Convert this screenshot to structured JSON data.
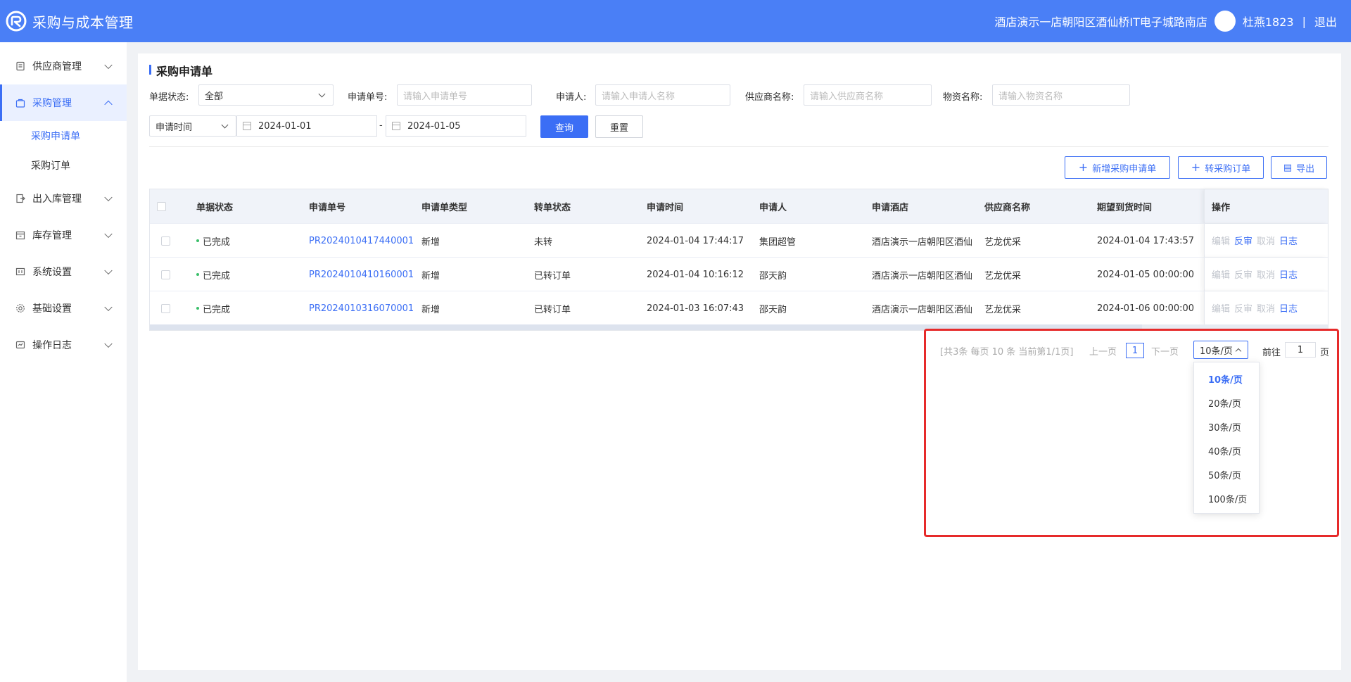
{
  "header": {
    "app_title": "采购与成本管理",
    "store_name": "酒店演示一店朝阳区酒仙桥IT电子城路南店",
    "user_name": "杜燕1823",
    "separator": "|",
    "logout": "退出",
    "brand_color": "#4a7ff6"
  },
  "sidebar": {
    "items": [
      {
        "label": "供应商管理",
        "icon": "supplier-icon"
      },
      {
        "label": "采购管理",
        "icon": "bag-icon",
        "active": true
      },
      {
        "label": "出入库管理",
        "icon": "inout-icon"
      },
      {
        "label": "库存管理",
        "icon": "inventory-icon"
      },
      {
        "label": "系统设置",
        "icon": "settings-icon"
      },
      {
        "label": "基础设置",
        "icon": "gear-icon"
      },
      {
        "label": "操作日志",
        "icon": "log-icon"
      }
    ],
    "purchase_sub": [
      {
        "label": "采购申请单",
        "current": true
      },
      {
        "label": "采购订单"
      }
    ]
  },
  "page": {
    "title": "采购申请单"
  },
  "filters": {
    "status_label": "单据状态:",
    "status_value": "全部",
    "order_no_label": "申请单号:",
    "order_no_placeholder": "请输入申请单号",
    "applicant_label": "申请人:",
    "applicant_placeholder": "请输入申请人名称",
    "supplier_label": "供应商名称:",
    "supplier_placeholder": "请输入供应商名称",
    "material_label": "物资名称:",
    "material_placeholder": "请输入物资名称",
    "time_type": "申请时间",
    "date_start": "2024-01-01",
    "date_sep": "-",
    "date_end": "2024-01-05",
    "query": "查询",
    "reset": "重置"
  },
  "actions": {
    "add": "新增采购申请单",
    "convert": "转采购订单",
    "export": "导出"
  },
  "table": {
    "columns": [
      "单据状态",
      "申请单号",
      "申请单类型",
      "转单状态",
      "申请时间",
      "申请人",
      "申请酒店",
      "供应商名称",
      "期望到货时间",
      "操作"
    ],
    "rows": [
      {
        "status": "已完成",
        "no": "PR2024010417440001",
        "type": "新增",
        "convert": "未转",
        "time": "2024-01-04 17:44:17",
        "applicant": "集团超管",
        "hotel": "酒店演示一店朝阳区酒仙",
        "supplier": "艺龙优采",
        "expect": "2024-01-04 17:43:57"
      },
      {
        "status": "已完成",
        "no": "PR2024010410160001",
        "type": "新增",
        "convert": "已转订单",
        "time": "2024-01-04 10:16:12",
        "applicant": "邵天韵",
        "hotel": "酒店演示一店朝阳区酒仙",
        "supplier": "艺龙优采",
        "expect": "2024-01-05 00:00:00"
      },
      {
        "status": "已完成",
        "no": "PR2024010316070001",
        "type": "新增",
        "convert": "已转订单",
        "time": "2024-01-03 16:07:43",
        "applicant": "邵天韵",
        "hotel": "酒店演示一店朝阳区酒仙",
        "supplier": "艺龙优采",
        "expect": "2024-01-06 00:00:00"
      }
    ],
    "ops": [
      "编辑",
      "反审",
      "取消",
      "日志"
    ],
    "op_states": [
      [
        false,
        true,
        false,
        true
      ],
      [
        false,
        false,
        false,
        true
      ],
      [
        false,
        false,
        false,
        true
      ]
    ]
  },
  "pagination": {
    "summary": "[共3条 每页 10 条 当前第1/1页]",
    "prev": "上一页",
    "current_page": "1",
    "next": "下一页",
    "page_size": "10条/页",
    "goto_label": "前往",
    "goto_value": "1",
    "page_unit": "页",
    "size_options": [
      "10条/页",
      "20条/页",
      "30条/页",
      "40条/页",
      "50条/页",
      "100条/页"
    ]
  }
}
